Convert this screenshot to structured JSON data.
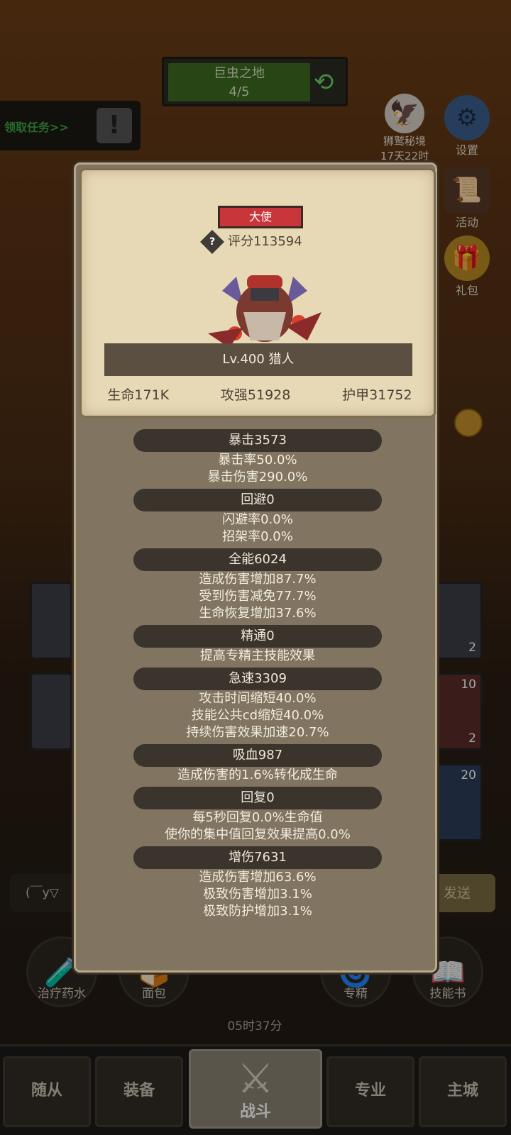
{
  "map": {
    "name": "巨虫之地",
    "progress": "4/5"
  },
  "task": {
    "label": "领取任务>>",
    "icon": "exclamation-icon"
  },
  "side": {
    "eagle_label": "狮鹫秘境",
    "eagle_timer": "17天22时",
    "settings": "设置",
    "activity": "活动",
    "gift": "礼包"
  },
  "popup": {
    "title_badge": "大使",
    "score": "评分113594",
    "level_name": "Lv.400 猎人",
    "hp": "生命171K",
    "atk": "攻强51928",
    "armor": "护甲31752",
    "sections": [
      {
        "head": "暴击3573",
        "lines": [
          "暴击率50.0%",
          "暴击伤害290.0%"
        ]
      },
      {
        "head": "回避0",
        "lines": [
          "闪避率0.0%",
          "招架率0.0%"
        ]
      },
      {
        "head": "全能6024",
        "lines": [
          "造成伤害增加87.7%",
          "受到伤害减免77.7%",
          "生命恢复增加37.6%"
        ]
      },
      {
        "head": "精通0",
        "lines": [
          "提高专精主技能效果"
        ]
      },
      {
        "head": "急速3309",
        "lines": [
          "攻击时间缩短40.0%",
          "技能公共cd缩短40.0%",
          "持续伤害效果加速20.7%"
        ]
      },
      {
        "head": "吸血987",
        "lines": [
          "造成伤害的1.6%转化成生命"
        ]
      },
      {
        "head": "回复0",
        "lines": [
          "每5秒回复0.0%生命值",
          "使你的集中值回复效果提高0.0%"
        ]
      },
      {
        "head": "增伤7631",
        "lines": [
          "造成伤害增加63.6%",
          "极致伤害增加3.1%",
          "极致防护增加3.1%"
        ]
      }
    ]
  },
  "chat": {
    "placeholder": "(￣y▽",
    "send": "发送"
  },
  "tiles": {
    "t1": "2",
    "t2a": "10",
    "t2b": "2",
    "t3": "20"
  },
  "quick": {
    "potion": "治疗药水",
    "bread": "面包",
    "timer": "05时37分",
    "spec": "专精",
    "skillbook": "技能书"
  },
  "tabs": {
    "followers": "随从",
    "equipment": "装备",
    "battle": "战斗",
    "profession": "专业",
    "city": "主城"
  }
}
